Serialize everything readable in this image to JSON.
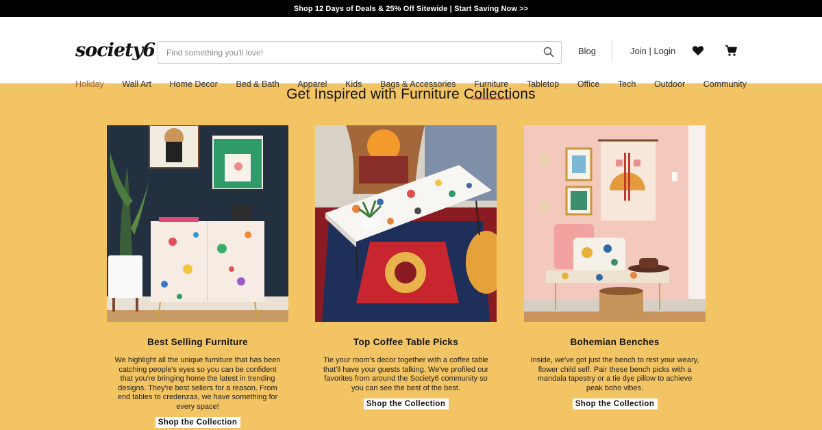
{
  "promo": {
    "text": "Shop 12 Days of Deals & 25% Off Sitewide | Start Saving Now >>"
  },
  "header": {
    "logo": "society6",
    "search_placeholder": "Find something you'll love!",
    "blog": "Blog",
    "login": "Join | Login",
    "icons": {
      "search": "search-icon",
      "wishlist": "heart-icon",
      "cart": "cart-icon"
    }
  },
  "nav": {
    "items": [
      "Holiday",
      "Wall Art",
      "Home Decor",
      "Bed & Bath",
      "Apparel",
      "Kids",
      "Bags & Accessories",
      "Furniture",
      "Tabletop",
      "Office",
      "Tech",
      "Outdoor",
      "Community"
    ],
    "active": "Furniture"
  },
  "main": {
    "heading": "Get Inspired with Furniture Collections",
    "cards": [
      {
        "title": "Best Selling Furniture",
        "description": "We highlight all the unique furniture that has been catching people's eyes so you can be confident that you're bringing home the latest in trending designs. They're best sellers for a reason. From end tables to credenzas, we have something for every space!",
        "cta": "Shop the Collection"
      },
      {
        "title": "Top Coffee Table Picks",
        "description": "Tie your room's decor together with a coffee table that'll have your guests talking. We've profiled our favorites from around the Society6 community so you can see the best of the best.",
        "cta": "Shop the Collection"
      },
      {
        "title": "Bohemian Benches",
        "description": "Inside, we've got just the bench to rest your weary, flower child self. Pair these bench picks with a mandala tapestry or a tie dye pillow to achieve peak boho vibes.",
        "cta": "Shop the Collection"
      }
    ]
  },
  "colors": {
    "background": "#f3c463",
    "promo_bar": "#000000",
    "nav_active": "#e3815f",
    "holiday": "#a0693a"
  }
}
